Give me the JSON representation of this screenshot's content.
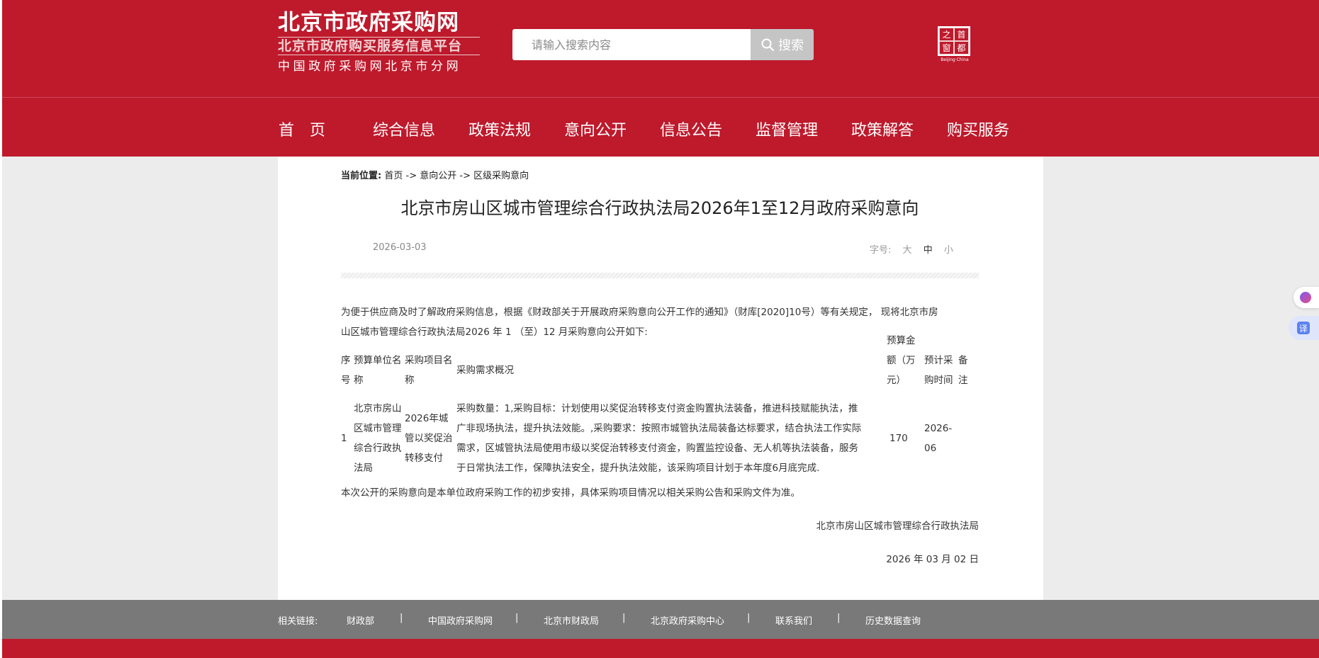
{
  "header": {
    "logo_main": "北京市政府采购网",
    "logo_sub": "北京市政府购买服务信息平台",
    "logo_foot": "中国政府采购网北京市分网",
    "search_placeholder": "请输入搜索内容",
    "search_button": "搜索",
    "seal_chars": [
      "之",
      "首",
      "窗",
      "都"
    ],
    "seal_caption": "Beijing·China"
  },
  "nav": {
    "items": [
      "首　页",
      "综合信息",
      "政策法规",
      "意向公开",
      "信息公告",
      "监督管理",
      "政策解答",
      "购买服务"
    ]
  },
  "breadcrumb": {
    "label": "当前位置:",
    "items": [
      "首页",
      "意向公开",
      "区级采购意向"
    ],
    "separator": "->"
  },
  "article": {
    "title": "北京市房山区城市管理综合行政执法局2026年1至12月政府采购意向",
    "date": "2026-03-03",
    "font_size_label": "字号:",
    "font_sizes": [
      "大",
      "中",
      "小"
    ],
    "intro_line1": "为便于供应商及时了解政府采购信息，根据《财政部关于开展政府采购意向公开工作的通知》（财库[2020]10号）等有关规定， 现将北京市房",
    "intro_line2": "山区城市管理综合行政执法局2026 年 1 （至）12 月采购意向公开如下:",
    "table": {
      "headers": {
        "seq": [
          "序",
          "号"
        ],
        "unit": [
          "预算单位名",
          "称"
        ],
        "project": [
          "采购项目名",
          "称"
        ],
        "summary": "采购需求概况",
        "budget": [
          "预算金",
          "额（万",
          "元）"
        ],
        "time": [
          "预计采",
          "购时间"
        ],
        "remark": [
          "备",
          "注"
        ]
      },
      "rows": [
        {
          "seq": "1",
          "unit": [
            "北京市房山",
            "区城市管理",
            "综合行政执",
            "法局"
          ],
          "project": [
            "2026年城",
            "管以奖促治",
            "转移支付"
          ],
          "summary": [
            "采购数量：1,采购目标：计划使用以奖促治转移支付资金购置执法装备，推进科技赋能执法，推",
            "广非现场执法，提升执法效能。,采购要求：按照市城管执法局装备达标要求，结合执法工作实际",
            "需求，区城管执法局使用市级以奖促治转移支付资金，购置监控设备、无人机等执法装备，服务",
            "于日常执法工作，保障执法安全，提升执法效能，该采购项目计划于本年度6月底完成."
          ],
          "budget": "170",
          "time": [
            "2026-",
            "06"
          ],
          "remark": ""
        }
      ]
    },
    "closing": "本次公开的采购意向是本单位政府采购工作的初步安排，具体采购项目情况以相关采购公告和采购文件为准。",
    "signature": "北京市房山区城市管理综合行政执法局",
    "sign_date": "2026 年 03 月 02 日"
  },
  "footer": {
    "label": "相关链接:",
    "links": [
      "财政部",
      "中国政府采购网",
      "北京市财政局",
      "北京政府采购中心",
      "联系我们",
      "历史数据查询"
    ],
    "separator": "|"
  },
  "widgets": {
    "translate_label": "译"
  },
  "colors": {
    "brand_red": "#be1a2c",
    "footer_gray": "#797979",
    "page_bg": "#ececec"
  }
}
